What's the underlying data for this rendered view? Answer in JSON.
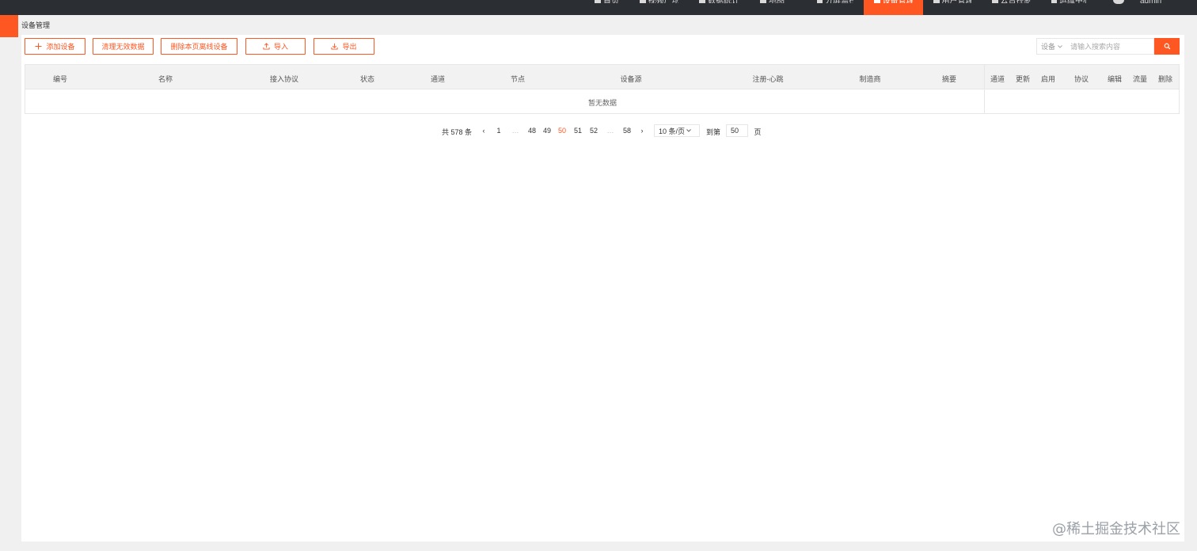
{
  "topnav": {
    "items": [
      {
        "label": "首页",
        "icon": "home-icon"
      },
      {
        "label": "视频广场",
        "icon": "video-icon"
      },
      {
        "label": "数据统计",
        "icon": "chart-icon"
      },
      {
        "label": "地图",
        "icon": "map-pin-icon"
      },
      {
        "label": "分屏监控",
        "icon": "monitor-icon"
      },
      {
        "label": "设备管理",
        "icon": "device-icon",
        "active": true
      },
      {
        "label": "用户管理",
        "icon": "user-icon"
      },
      {
        "label": "云台控制",
        "icon": "ptz-icon"
      },
      {
        "label": "运维中心",
        "icon": "gear-icon"
      }
    ],
    "user": "admin",
    "accent": "#ff5722",
    "background": "#2b2e33"
  },
  "breadcrumb": "设备管理",
  "toolbar": {
    "add": "添加设备",
    "clean": "清理无效数据",
    "delete_offline": "删除本页离线设备",
    "import": "导入",
    "export": "导出"
  },
  "search": {
    "type": "设备",
    "placeholder": "请输入搜索内容"
  },
  "table": {
    "columns": [
      "编号",
      "名称",
      "接入协议",
      "状态",
      "通道",
      "节点",
      "设备源",
      "注册-心跳",
      "制造商",
      "摘要"
    ],
    "fixed_columns": [
      "通道",
      "更新",
      "启用",
      "协议",
      "编辑",
      "流量",
      "删除"
    ],
    "empty": "暂无数据"
  },
  "pagination": {
    "total_text": "共 578 条",
    "pages": [
      "1",
      "…",
      "48",
      "49",
      "50",
      "51",
      "52",
      "…",
      "58"
    ],
    "current": "50",
    "page_size": "10 条/页",
    "jump_label": "到第",
    "jump_value": "50",
    "page_suffix": "页"
  },
  "watermark": "@稀土掘金技术社区"
}
